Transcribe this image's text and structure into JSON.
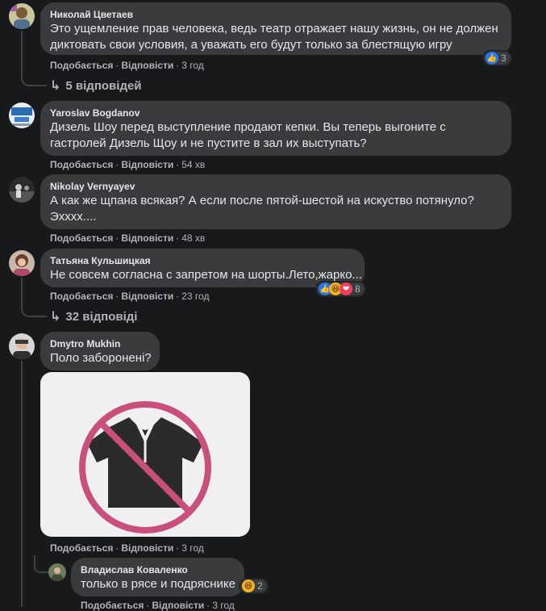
{
  "comments": [
    {
      "author": "Николай Цветаев",
      "lines": [
        "Это ущемление прав человека, ведь театр отражает нашу жизнь, он не должен",
        "диктовать свои условия, а уважать его будут только за блестящую игру"
      ],
      "like": "Подобається",
      "reply": "Відповісти",
      "time": "3 год",
      "reaction_count": "3",
      "replies_label": "5 відповідей"
    },
    {
      "author": "Yaroslav Bogdanov",
      "lines": [
        "Дизель Шоу перед выступление продают кепки. Вы теперь выгоните с",
        "гастролей Дизель Щоу и не пустите в зал их выступать?"
      ],
      "like": "Подобається",
      "reply": "Відповісти",
      "time": "54 хв"
    },
    {
      "author": "Nikolay Vernyayev",
      "lines": [
        "А как же щпана всякая? А если после пятой-шестой на искуство потянуло?",
        "Эхххх...."
      ],
      "like": "Подобається",
      "reply": "Відповісти",
      "time": "48 хв"
    },
    {
      "author": "Татьяна Кульшицкая",
      "lines": [
        "Не совсем согласна с запретом на шорты.Лето,жарко..."
      ],
      "like": "Подобається",
      "reply": "Відповісти",
      "time": "23 год",
      "reaction_count": "8",
      "replies_label": "32 відповіді"
    },
    {
      "author": "Dmytro Mukhin",
      "lines": [
        "Поло заборонені?"
      ],
      "like": "Подобається",
      "reply": "Відповісти",
      "time": "3 год"
    },
    {
      "author": "Владислав Коваленко",
      "lines": [
        "только в рясе и подряснике"
      ],
      "like": "Подобається",
      "reply": "Відповісти",
      "time": "3 год",
      "reaction_count": "2"
    }
  ],
  "icons": {
    "like": "like-icon",
    "haha": "haha-icon",
    "love": "love-icon",
    "reply_arrow": "reply-arrow-icon",
    "no_polo": "no-polo-shirt-icon"
  },
  "colors": {
    "background": "#18191a",
    "bubble": "#3a3b3c",
    "secondary_text": "#b0b3b8",
    "like_blue": "#2078f4",
    "prohibition_pink": "#c8507a"
  }
}
